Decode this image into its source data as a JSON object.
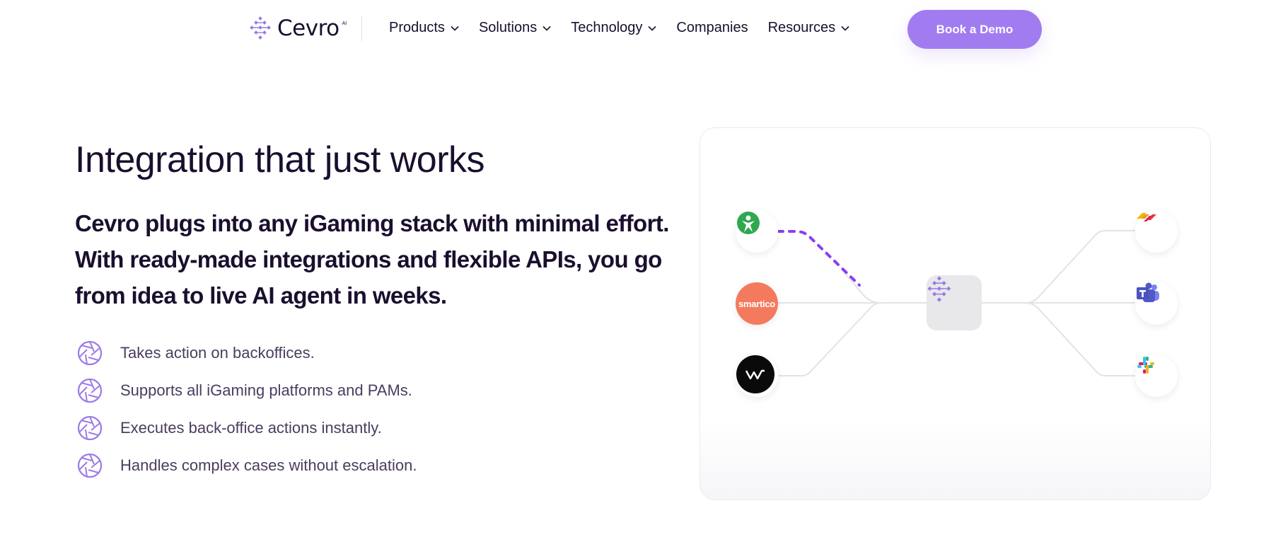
{
  "nav": {
    "logo_text": "Cevro",
    "logo_tm": "AI",
    "items": [
      {
        "label": "Products",
        "has_dropdown": true
      },
      {
        "label": "Solutions",
        "has_dropdown": true
      },
      {
        "label": "Technology",
        "has_dropdown": true
      },
      {
        "label": "Companies",
        "has_dropdown": false
      },
      {
        "label": "Resources",
        "has_dropdown": true
      }
    ],
    "cta_label": "Book a Demo"
  },
  "hero": {
    "title": "Integration that just works",
    "lead": "Cevro plugs into any iGaming stack with minimal effort. With ready-made integrations and flexible APIs, you go from idea to live AI agent in weeks.",
    "features": [
      {
        "icon": "aperture-icon",
        "text": "Takes action on backoffices."
      },
      {
        "icon": "aperture-icon",
        "text": "Supports all iGaming platforms and PAMs."
      },
      {
        "icon": "aperture-icon",
        "text": "Executes back-office actions instantly."
      },
      {
        "icon": "aperture-icon",
        "text": "Handles complex cases without escalation."
      }
    ]
  },
  "diagram": {
    "left_nodes": [
      {
        "icon": "evolution-logo-icon"
      },
      {
        "icon": "smartico-logo-icon",
        "label": "smartico"
      },
      {
        "icon": "w-brand-logo-icon"
      }
    ],
    "hub_icon": "cevro-logo-icon",
    "right_nodes": [
      {
        "icon": "zendesk-style-logo-icon"
      },
      {
        "icon": "teams-logo-icon"
      },
      {
        "icon": "slack-logo-icon"
      }
    ]
  },
  "colors": {
    "brand_purple": "#a07cf0",
    "dashed_line": "#8a3ff0",
    "text_dark": "#1a0f2e",
    "text_muted": "#4a3d5e",
    "smartico_orange": "#f47a5e"
  }
}
